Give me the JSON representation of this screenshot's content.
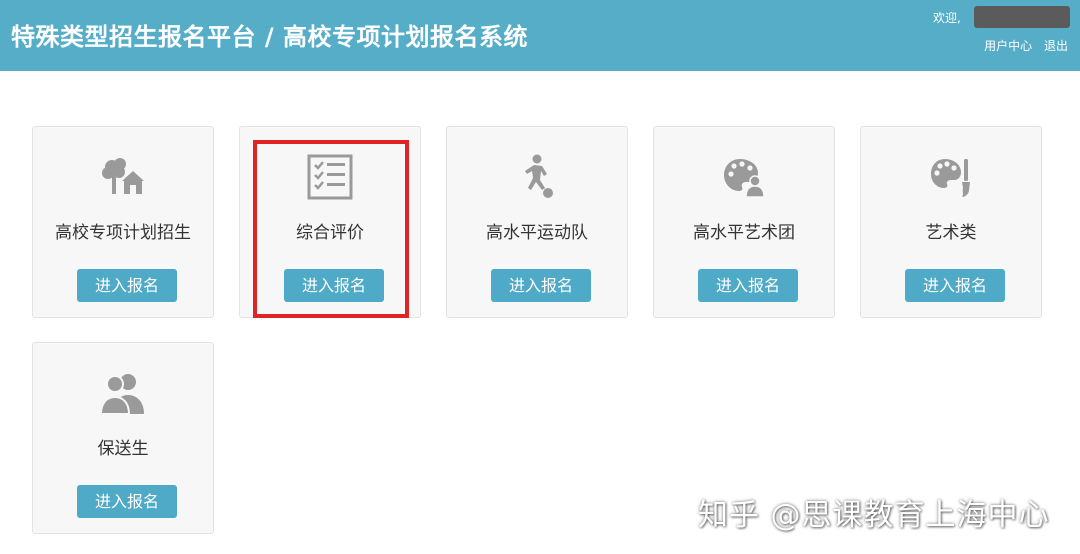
{
  "header": {
    "title": "特殊类型招生报名平台 / 高校专项计划报名系统",
    "welcome_text": "欢迎,",
    "links": [
      "用户中心",
      "退出"
    ]
  },
  "cards": [
    {
      "label": "高校专项计划招生",
      "icon": "tree-house-icon",
      "button": "进入报名"
    },
    {
      "label": "综合评价",
      "icon": "checklist-icon",
      "button": "进入报名",
      "highlighted": true
    },
    {
      "label": "高水平运动队",
      "icon": "runner-ball-icon",
      "button": "进入报名"
    },
    {
      "label": "高水平艺术团",
      "icon": "palette-person-icon",
      "button": "进入报名"
    },
    {
      "label": "艺术类",
      "icon": "palette-brush-icon",
      "button": "进入报名"
    },
    {
      "label": "保送生",
      "icon": "users-icon",
      "button": "进入报名"
    }
  ],
  "watermark": "知乎 @思课教育上海中心",
  "colors": {
    "header_bg": "#56adc8",
    "button_bg": "#4eaac6",
    "highlight": "#e02424",
    "icon": "#9a9a9a"
  }
}
